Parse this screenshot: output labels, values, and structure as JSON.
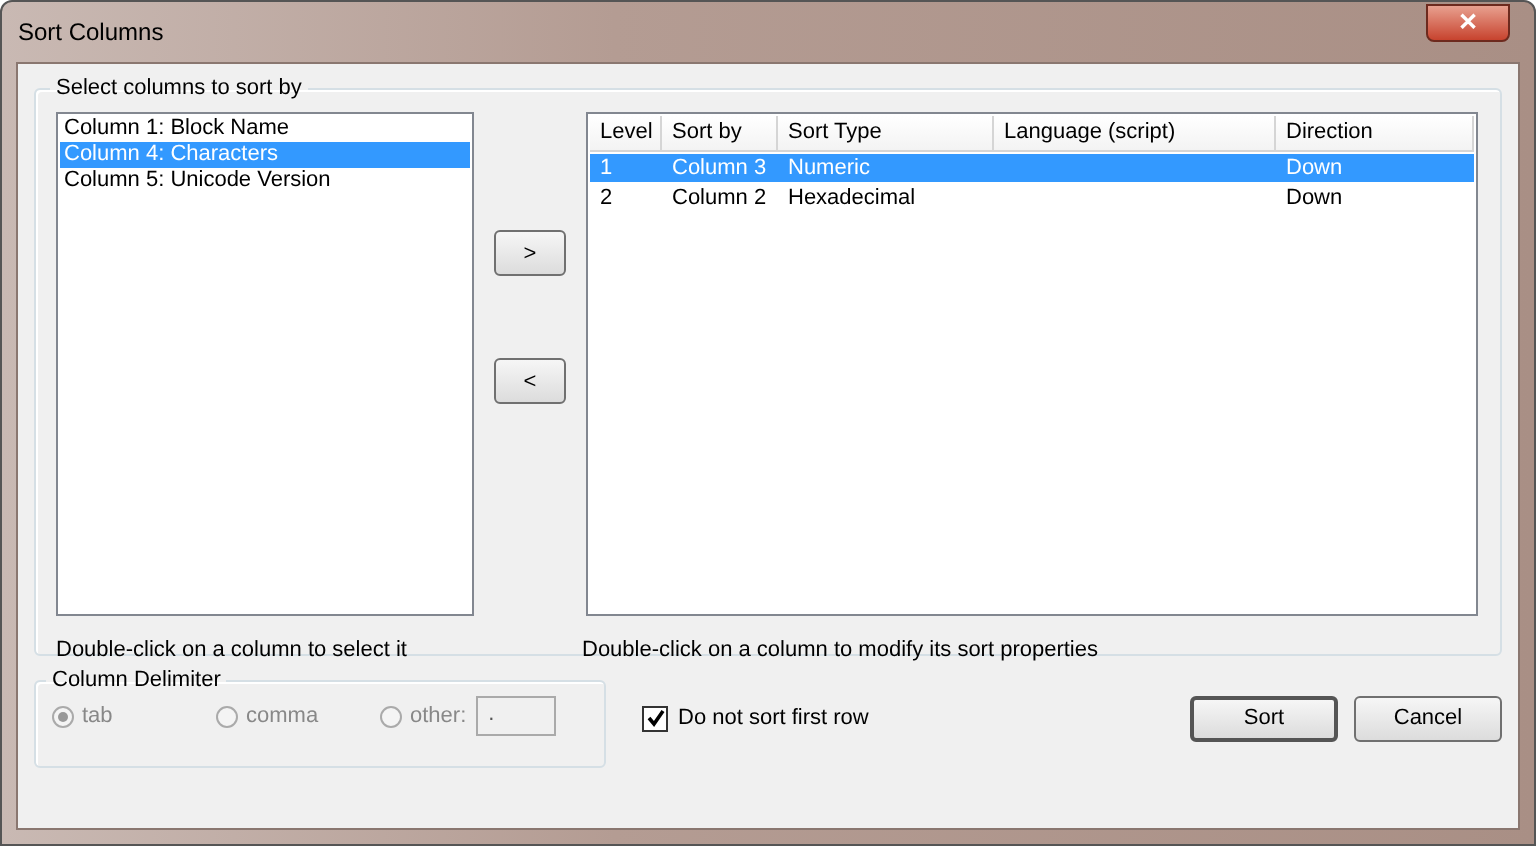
{
  "window": {
    "title": "Sort Columns",
    "close_label": "✕"
  },
  "select_group": {
    "title": "Select columns to sort by",
    "available": [
      {
        "label": "Column 1: Block Name",
        "selected": false
      },
      {
        "label": "Column 4: Characters",
        "selected": true
      },
      {
        "label": "Column 5: Unicode Version",
        "selected": false
      }
    ],
    "add_button": ">",
    "remove_button": "<",
    "table": {
      "columns": [
        "Level",
        "Sort by",
        "Sort Type",
        "Language (script)",
        "Direction"
      ],
      "rows": [
        {
          "cells": [
            "1",
            "Column 3",
            "Numeric",
            "",
            "Down"
          ],
          "selected": true
        },
        {
          "cells": [
            "2",
            "Column 2",
            "Hexadecimal",
            "",
            "Down"
          ],
          "selected": false
        }
      ]
    },
    "left_hint": "Double-click on a column to select it",
    "right_hint": "Double-click on a column to modify its sort properties"
  },
  "delimiter": {
    "title": "Column Delimiter",
    "disabled": true,
    "options": [
      {
        "label": "tab",
        "selected": true
      },
      {
        "label": "comma",
        "selected": false
      },
      {
        "label": "other:",
        "selected": false
      }
    ],
    "other_value": "."
  },
  "skip_first_row": {
    "label": "Do not sort first row",
    "checked": true
  },
  "buttons": [
    "Sort",
    "Cancel"
  ]
}
